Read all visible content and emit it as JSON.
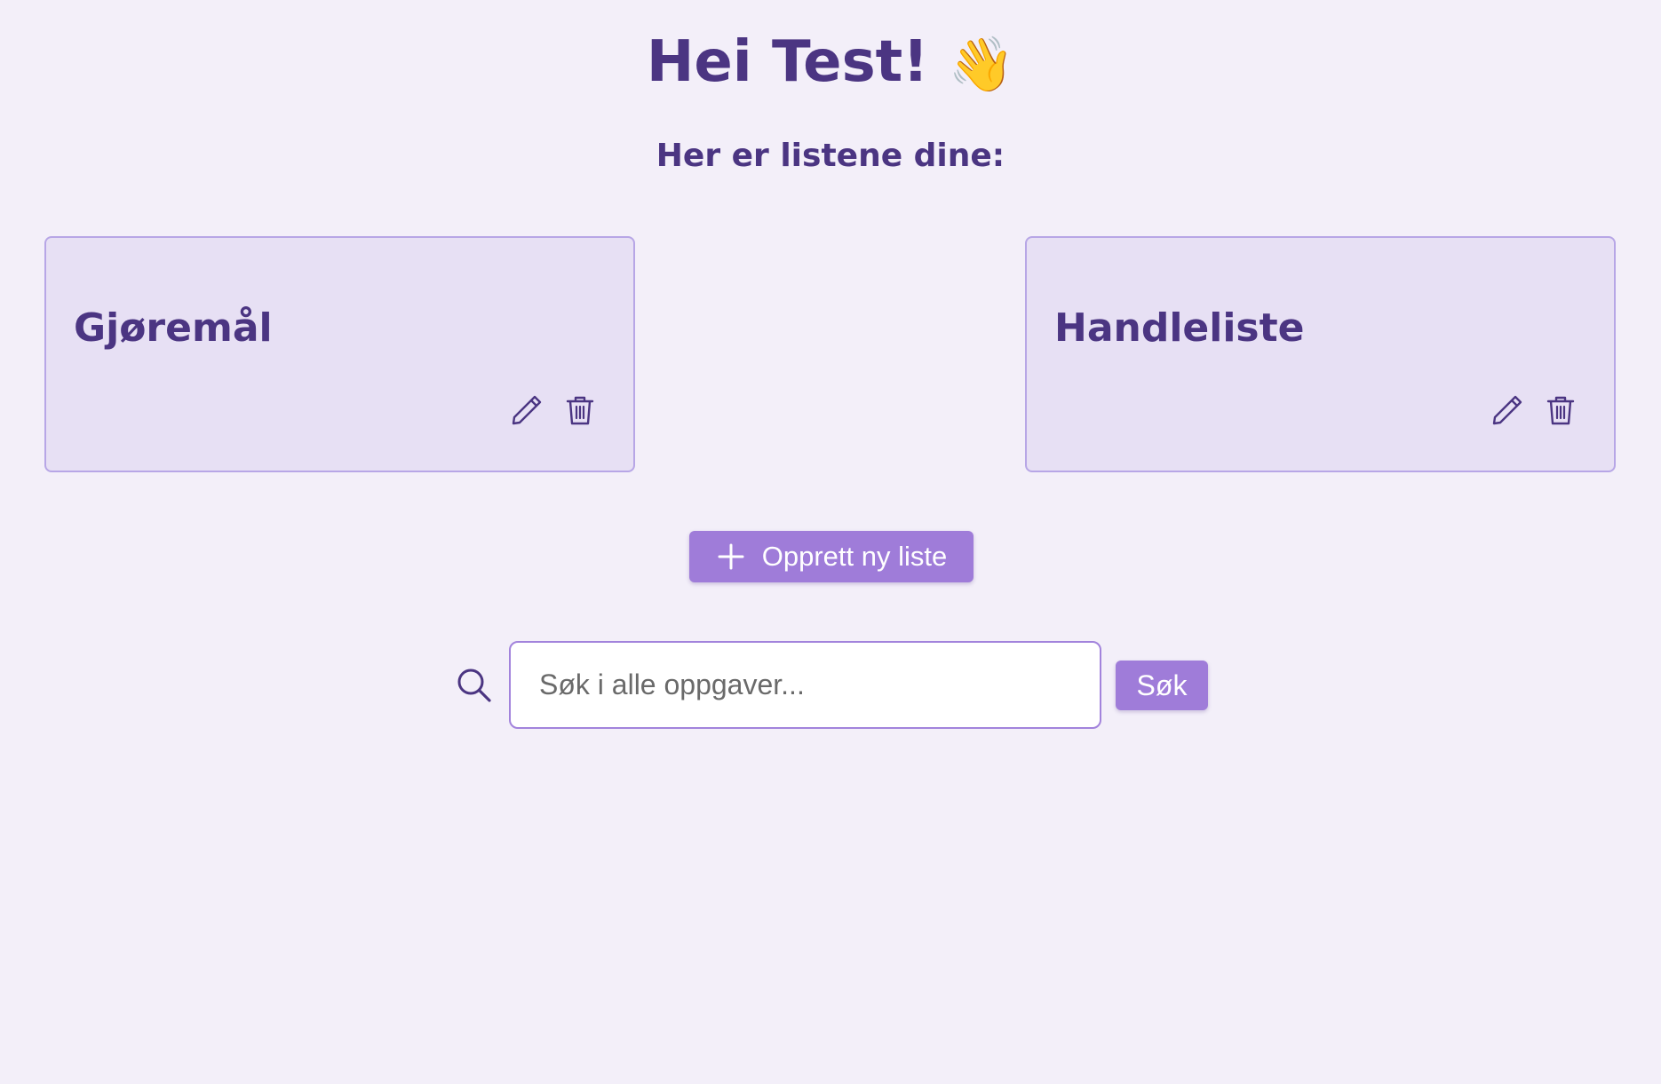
{
  "header": {
    "greeting": "Hei Test!",
    "wave_emoji": "👋",
    "subtitle": "Her er listene dine:"
  },
  "lists": [
    {
      "title": "Gjøremål",
      "edit_icon": "pencil-icon",
      "delete_icon": "trash-icon"
    },
    {
      "title": "Handleliste",
      "edit_icon": "pencil-icon",
      "delete_icon": "trash-icon"
    }
  ],
  "create_button": {
    "icon": "plus-icon",
    "label": "Opprett ny liste"
  },
  "search": {
    "icon": "search-icon",
    "placeholder": "Søk i alle oppgaver...",
    "value": "",
    "button_label": "Søk"
  },
  "colors": {
    "background": "#f3eff9",
    "text": "#4b3582",
    "card_bg": "#e7e0f4",
    "card_border": "#b7a6e6",
    "accent": "#9f7cd9"
  }
}
